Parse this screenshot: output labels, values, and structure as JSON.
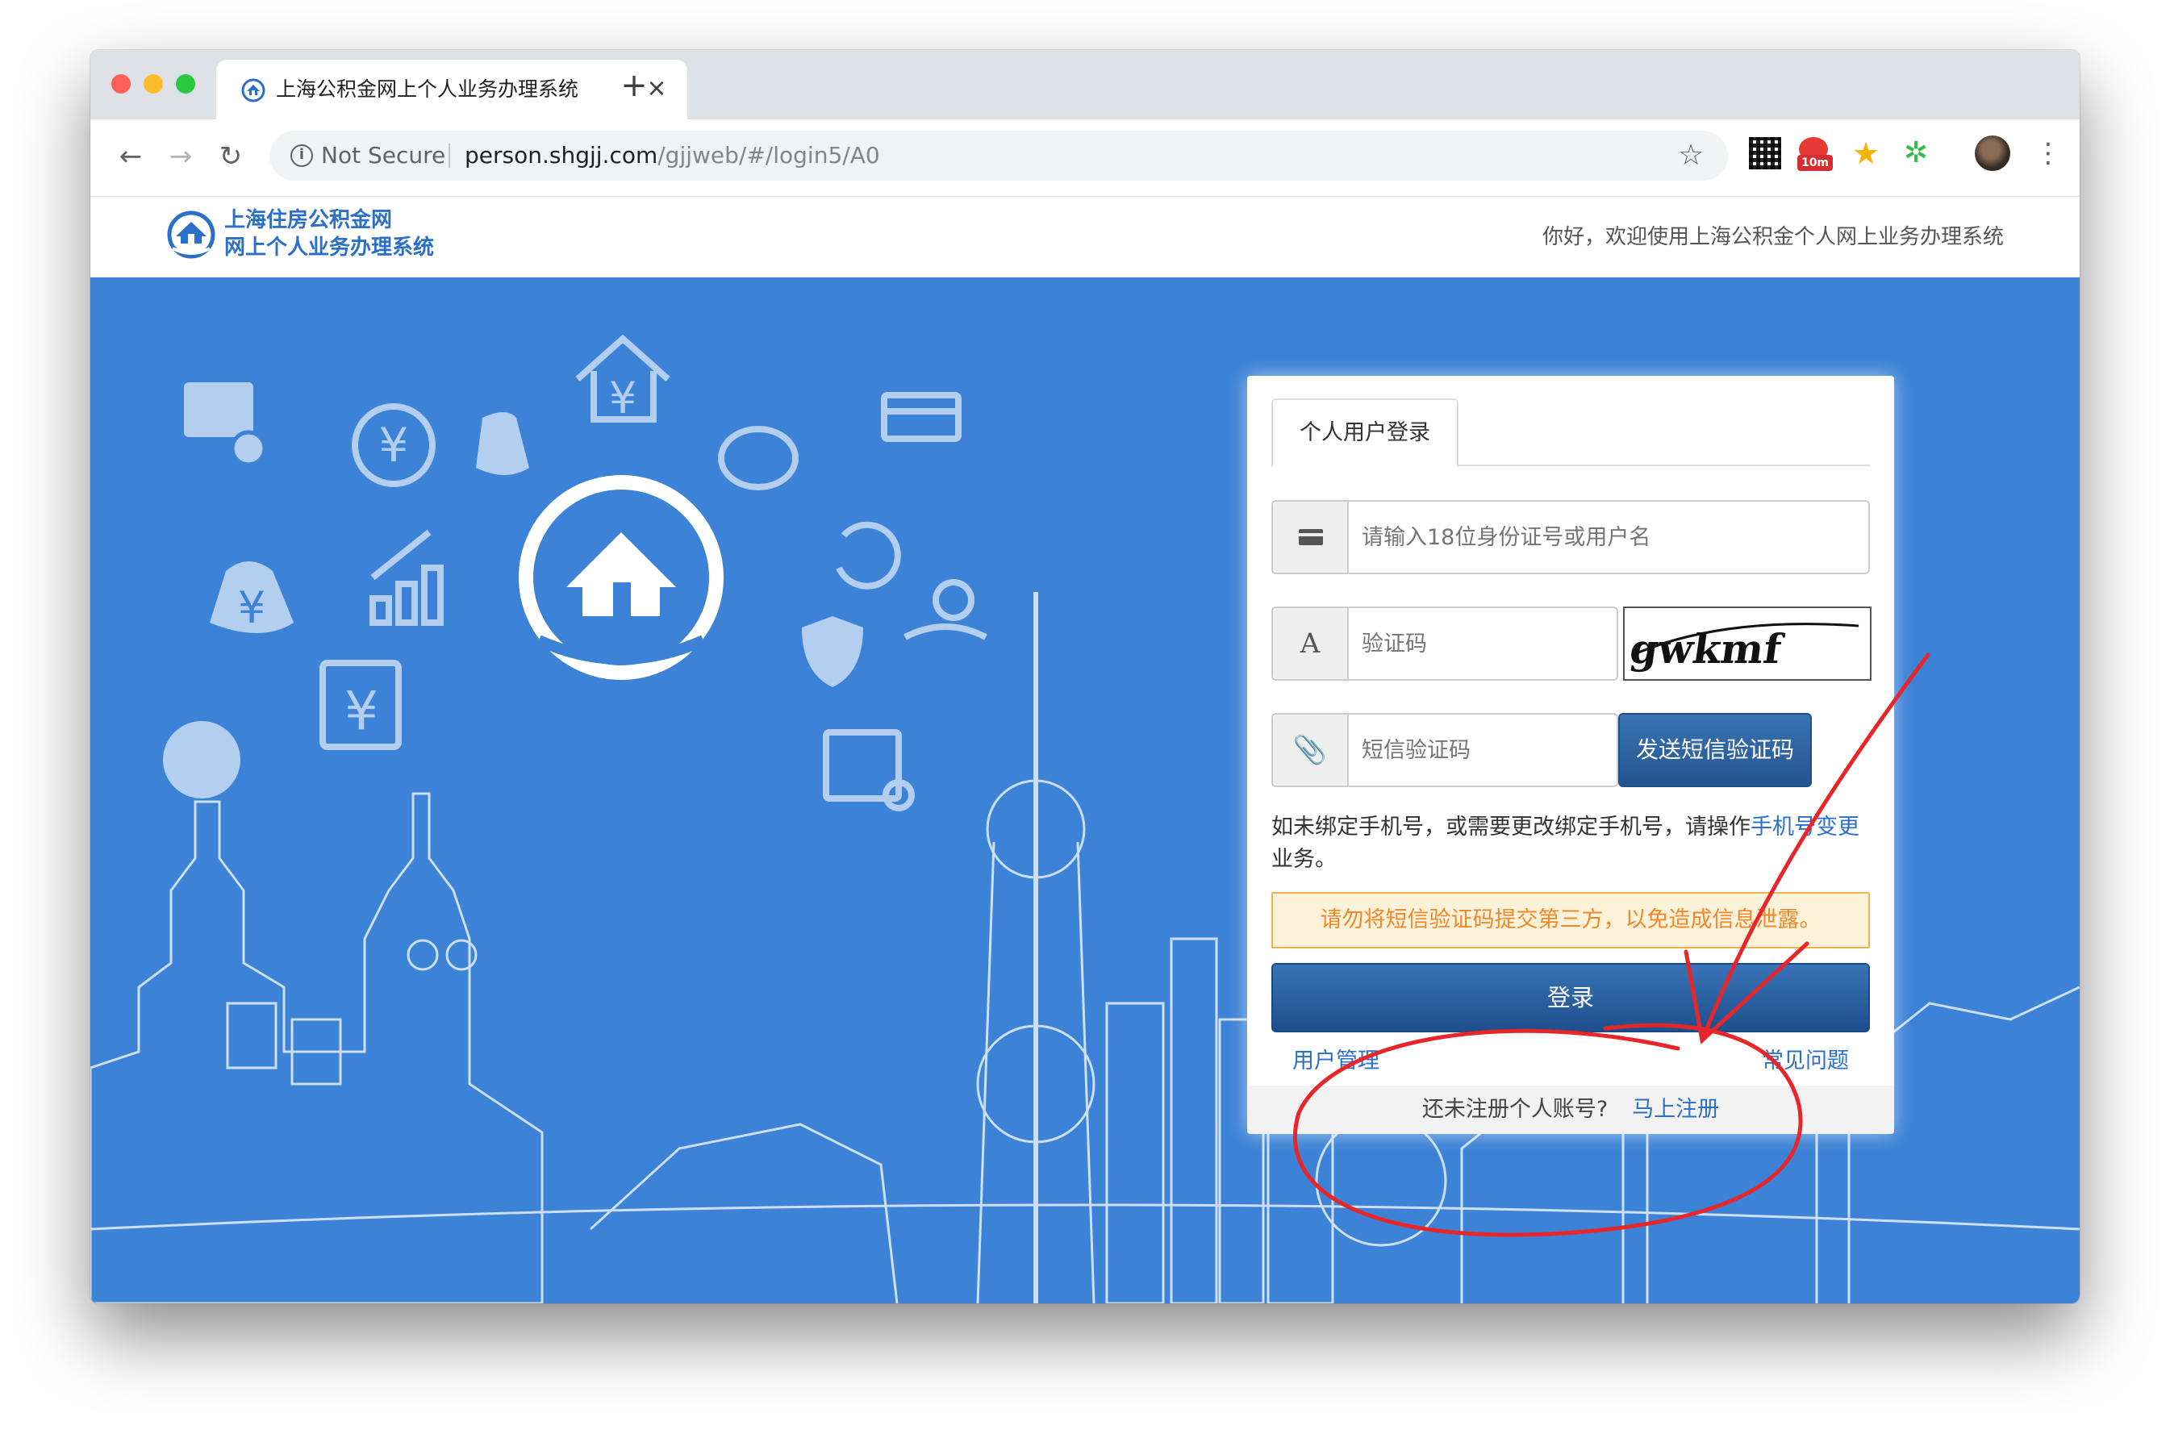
{
  "browser": {
    "tab_title": "上海公积金网上个人业务办理系统",
    "tab_close": "×",
    "new_tab": "+",
    "security_label": "Not Secure",
    "url_host": "person.shgjj.com",
    "url_path": "/gjjweb/#/login5/A0",
    "extension_badge": "10m",
    "icons": [
      "back-icon",
      "forward-icon",
      "reload-icon",
      "info-icon",
      "star-icon",
      "qr-code-icon",
      "tomato-timer-icon",
      "favorite-star-icon",
      "green-extension-icon",
      "profile-avatar",
      "menu-icon"
    ]
  },
  "site": {
    "name_line1": "上海住房公积金网",
    "name_line2": "网上个人业务办理系统",
    "welcome": "你好，欢迎使用上海公积金个人网上业务办理系统",
    "brand_color": "#3c82d6"
  },
  "login": {
    "tab_label": "个人用户登录",
    "id_placeholder": "请输入18位身份证号或用户名",
    "captcha_addon": "A",
    "captcha_placeholder": "验证码",
    "captcha_text": "gwkmf",
    "sms_placeholder": "短信验证码",
    "sms_button": "发送短信验证码",
    "hint_prefix": "如未绑定手机号，或需要更改绑定手机号，请操作",
    "hint_link": "手机号变更",
    "hint_suffix": "业务。",
    "warning": "请勿将短信验证码提交第三方，以免造成信息泄露。",
    "login_button": "登录",
    "user_manage": "用户管理",
    "faq": "常见问题",
    "register_prompt": "还未注册个人账号?",
    "register_link": "马上注册"
  },
  "annotation": {
    "color": "#e8262a"
  }
}
